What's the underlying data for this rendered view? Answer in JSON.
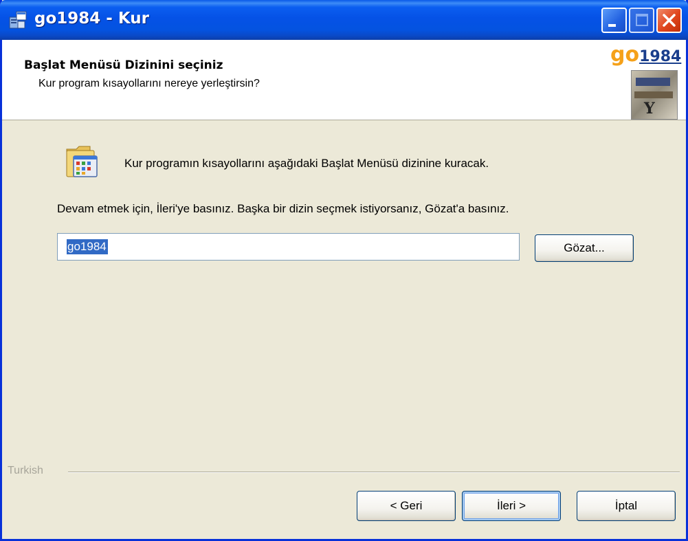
{
  "window": {
    "title": "go1984 - Kur"
  },
  "header": {
    "title": "Başlat Menüsü Dizinini seçiniz",
    "subtitle": "Kur program kısayollarını nereye yerleştirsin?",
    "logo_go": "go",
    "logo_num": "1984"
  },
  "body": {
    "info_text": "Kur programın kısayollarını aşağıdaki Başlat Menüsü dizinine kuracak.",
    "instruction": "Devam etmek için, İleri'ye basınız. Başka bir dizin seçmek istiyorsanız, Gözat'a basınız.",
    "folder_value": "go1984",
    "browse_label": "Gözat..."
  },
  "footer": {
    "language_label": "Turkish",
    "back_label": "< Geri",
    "next_label": "İleri >",
    "cancel_label": "İptal"
  },
  "colors": {
    "titlebar": "#0552e6",
    "selection": "#316ac5",
    "dialog_bg": "#ece9d8"
  },
  "icons": {
    "app": "installer-icon",
    "folder": "start-menu-folder-icon",
    "minimize": "minimize-icon",
    "maximize": "maximize-icon",
    "close": "close-icon"
  }
}
